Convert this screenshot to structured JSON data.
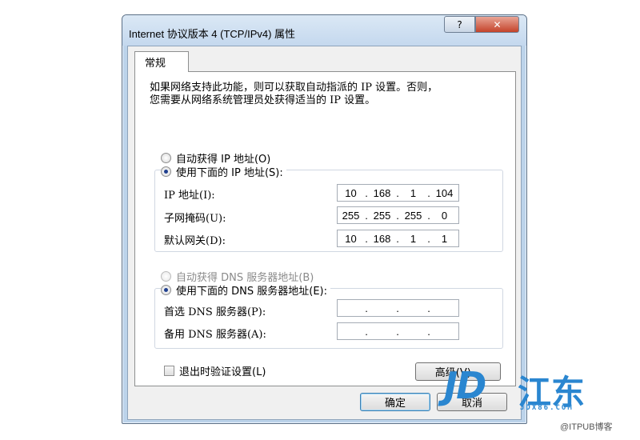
{
  "window": {
    "title": "Internet 协议版本 4 (TCP/IPv4) 属性",
    "help_label": "?",
    "close_label": "✕"
  },
  "tab": {
    "label": "常规"
  },
  "description": {
    "line1": "如果网络支持此功能，则可以获取自动指派的 IP 设置。否则，",
    "line2": "您需要从网络系统管理员处获得适当的 IP 设置。"
  },
  "ip": {
    "auto_label": "自动获得 IP 地址(O)",
    "manual_label": "使用下面的 IP 地址(S):",
    "selected": "manual",
    "fields": [
      {
        "label": "IP 地址(I):",
        "parts": [
          "10",
          "168",
          "1",
          "104"
        ]
      },
      {
        "label": "子网掩码(U):",
        "parts": [
          "255",
          "255",
          "255",
          "0"
        ]
      },
      {
        "label": "默认网关(D):",
        "parts": [
          "10",
          "168",
          "1",
          "1"
        ]
      }
    ]
  },
  "dns": {
    "auto_label": "自动获得 DNS 服务器地址(B)",
    "manual_label": "使用下面的 DNS 服务器地址(E):",
    "selected": "manual",
    "fields": [
      {
        "label": "首选 DNS 服务器(P):",
        "parts": [
          "",
          "",
          "",
          ""
        ]
      },
      {
        "label": "备用 DNS 服务器(A):",
        "parts": [
          "",
          "",
          "",
          ""
        ]
      }
    ]
  },
  "validate_checkbox": {
    "label": "退出时验证设置(L)",
    "checked": false
  },
  "buttons": {
    "advanced": "高级(V)...",
    "ok": "确定",
    "cancel": "取消"
  },
  "watermark": {
    "logo": "JD",
    "chinese": "江东",
    "url": "JDX86.COM"
  },
  "credit": "@ITPUB博客"
}
